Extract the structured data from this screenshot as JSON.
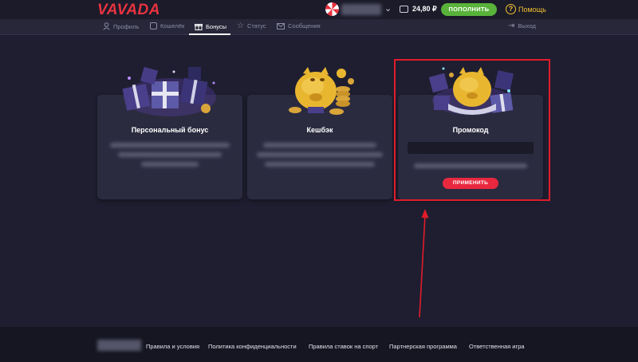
{
  "header": {
    "logo": "VAVADA",
    "balance": "24,80 ₽",
    "deposit_label": "ПОПОЛНИТЬ",
    "help_label": "Помощь"
  },
  "nav": {
    "items": [
      {
        "label": "Профиль",
        "icon": "user-icon"
      },
      {
        "label": "Кошелёк",
        "icon": "wallet-icon"
      },
      {
        "label": "Бонусы",
        "icon": "gift-icon",
        "active": true
      },
      {
        "label": "Статус",
        "icon": "star-icon"
      },
      {
        "label": "Сообщения",
        "icon": "mail-icon"
      }
    ],
    "logout_label": "Выход"
  },
  "cards": [
    {
      "title": "Персональный бонус",
      "image": "gift-boxes-image"
    },
    {
      "title": "Кешбэк",
      "image": "piggy-bank-coins-image"
    },
    {
      "title": "Промокод",
      "image": "piggy-bank-gifts-image",
      "button_label": "ПРИМЕНИТЬ"
    }
  ],
  "footer": {
    "links": [
      "Правила и условия",
      "Политика конфиденциальности",
      "Правила ставок на спорт",
      "Партнерская программа",
      "Ответственная игра"
    ]
  },
  "colors": {
    "background": "#1e1e30",
    "card": "#2b2b40",
    "accent_red": "#e8283f",
    "deposit_green": "#59b33b",
    "help_yellow": "#f2c230",
    "highlight_box": "#e01c2a"
  }
}
